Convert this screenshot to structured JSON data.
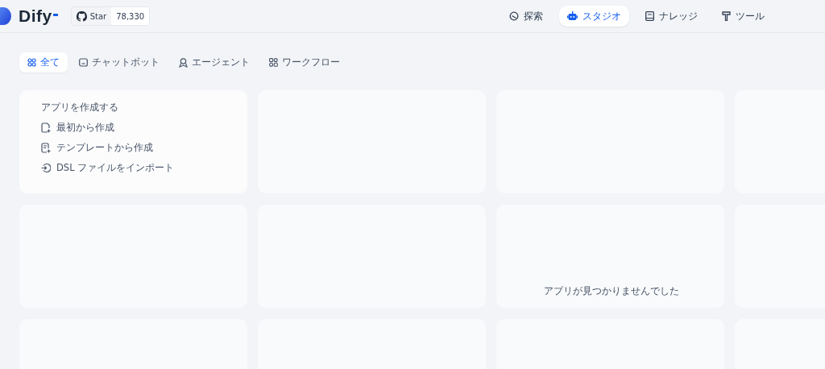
{
  "header": {
    "logo": "Dify",
    "github": {
      "label": "Star",
      "count": "78,330"
    },
    "nav": [
      {
        "kind": "explore",
        "label": "探索",
        "selected": false
      },
      {
        "kind": "studio",
        "label": "スタジオ",
        "selected": true
      },
      {
        "kind": "knowledge",
        "label": "ナレッジ",
        "selected": false
      },
      {
        "kind": "tools",
        "label": "ツール",
        "selected": false
      }
    ]
  },
  "filters": [
    {
      "kind": "all",
      "label": "全て",
      "selected": true
    },
    {
      "kind": "chatbot",
      "label": "チャットボット",
      "selected": false
    },
    {
      "kind": "agent",
      "label": "エージェント",
      "selected": false
    },
    {
      "kind": "workflow",
      "label": "ワークフロー",
      "selected": false
    }
  ],
  "create_card": {
    "title": "アプリを作成する",
    "actions": [
      {
        "kind": "blank",
        "label": "最初から作成"
      },
      {
        "kind": "template",
        "label": "テンプレートから作成"
      },
      {
        "kind": "import",
        "label": "DSL ファイルをインポート"
      }
    ]
  },
  "empty_message": "アプリが見つかりませんでした"
}
